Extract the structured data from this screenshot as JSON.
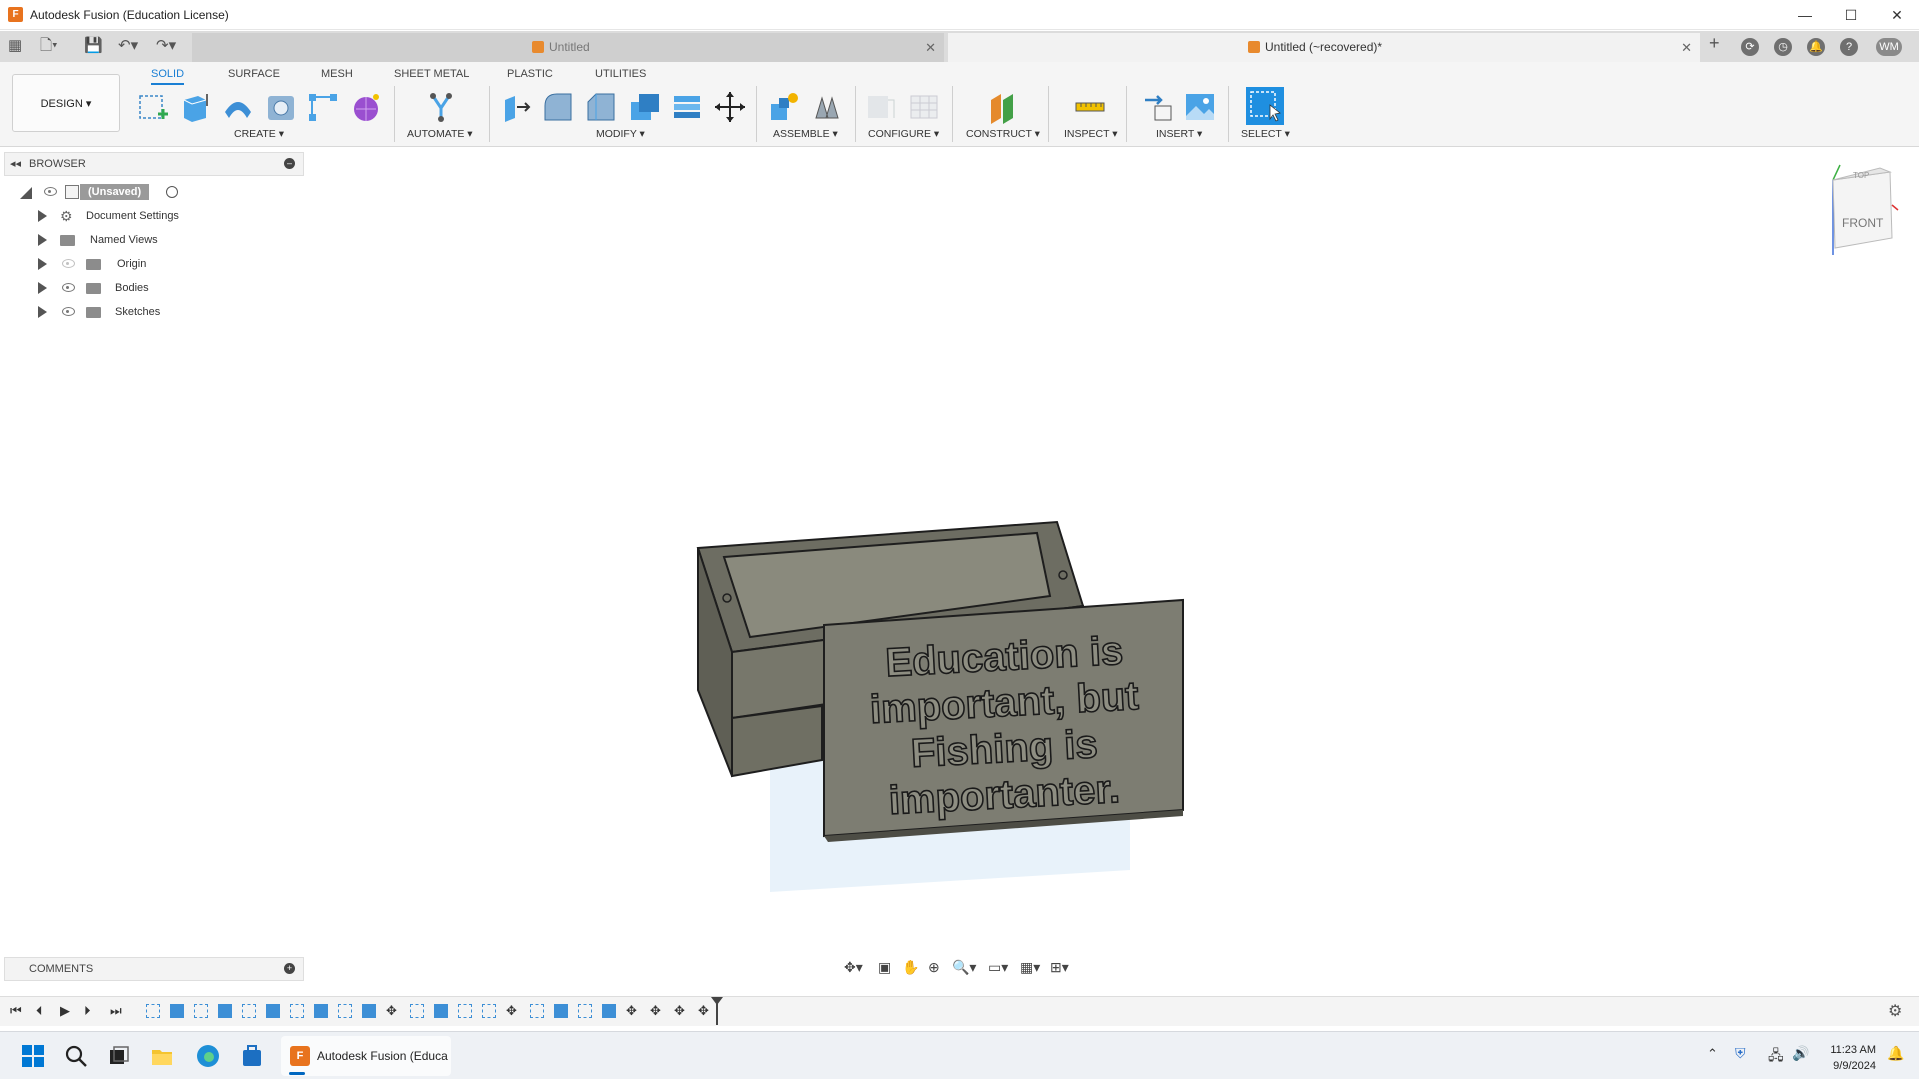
{
  "window": {
    "title": "Autodesk Fusion (Education License)",
    "min": "—",
    "max": "☐",
    "close": "✕"
  },
  "tabs": [
    {
      "label": "Untitled",
      "close": "✕"
    },
    {
      "label": "Untitled (~recovered)*",
      "close": "✕"
    }
  ],
  "header": {
    "user_initials": "WM",
    "help": "?",
    "new_tab": "+"
  },
  "toolbar": {
    "workspace": "DESIGN ▾",
    "ws_tabs": [
      "SOLID",
      "SURFACE",
      "MESH",
      "SHEET METAL",
      "PLASTIC",
      "UTILITIES"
    ],
    "groups": {
      "create": "CREATE ▾",
      "automate": "AUTOMATE ▾",
      "modify": "MODIFY ▾",
      "assemble": "ASSEMBLE ▾",
      "configure": "CONFIGURE ▾",
      "construct": "CONSTRUCT ▾",
      "inspect": "INSPECT ▾",
      "insert": "INSERT ▾",
      "select": "SELECT ▾"
    }
  },
  "browser": {
    "title": "BROWSER",
    "root": "(Unsaved)",
    "items": [
      "Document Settings",
      "Named Views",
      "Origin",
      "Bodies",
      "Sketches"
    ]
  },
  "viewcube": {
    "front": "FRONT",
    "top": "TOP"
  },
  "model_text": [
    "Education is",
    "important, but",
    "Fishing is",
    "importanter."
  ],
  "comments": {
    "title": "COMMENTS"
  },
  "taskbar": {
    "app_label": "Autodesk Fusion (Educa",
    "time": "11:23 AM",
    "date": "9/9/2024"
  },
  "colors": {
    "accent": "#1a7fd4",
    "model": "#7a7a6e",
    "brand": "#e8731e"
  }
}
